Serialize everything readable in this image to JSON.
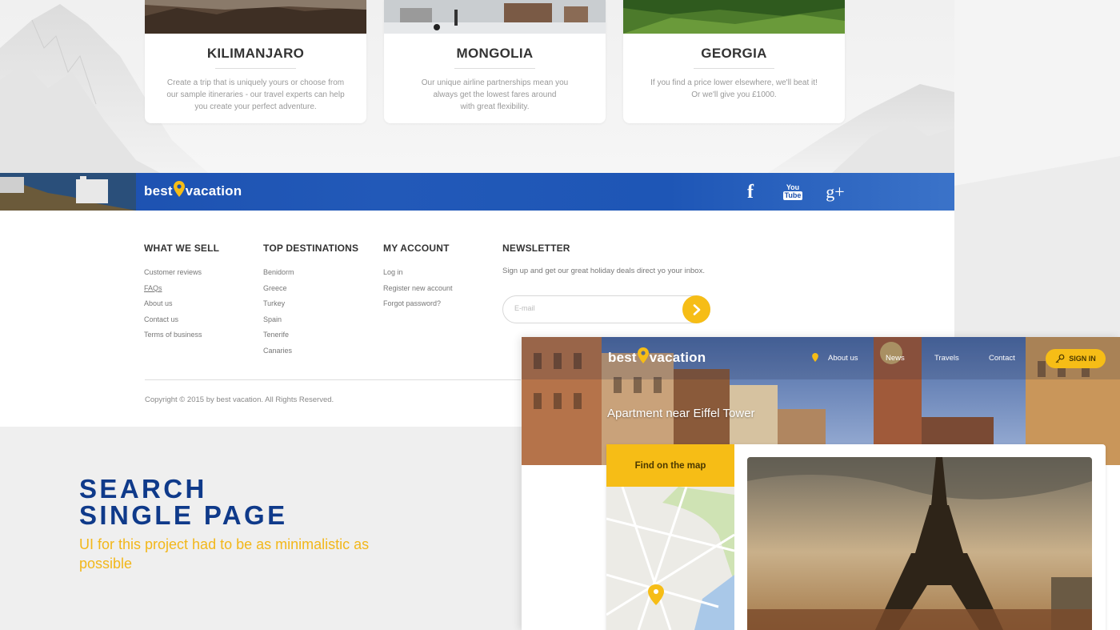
{
  "cards": [
    {
      "title": "KILIMANJARO",
      "lines": [
        "Create a trip that is uniquely yours or choose from",
        "our sample itineraries - our travel experts can help",
        "you create your perfect adventure."
      ]
    },
    {
      "title": "MONGOLIA",
      "lines": [
        "Our unique airline partnerships mean you",
        "always get the lowest fares around",
        "with great flexibility."
      ]
    },
    {
      "title": "GEORGIA",
      "lines": [
        "If you find a price lower elsewhere, we'll beat it!",
        "Or we'll give you £1000."
      ]
    }
  ],
  "brand": {
    "left": "best",
    "right": "vacation"
  },
  "social": {
    "facebook": "f",
    "youtube_top": "You",
    "youtube_bottom": "Tube",
    "google": "g+"
  },
  "footer": {
    "columns": [
      {
        "heading": "WHAT WE SELL",
        "items": [
          "Customer reviews",
          "FAQs",
          "About us",
          "Contact us",
          "Terms of business"
        ]
      },
      {
        "heading": "TOP DESTINATIONS",
        "items": [
          "Benidorm",
          "Greece",
          "Turkey",
          "Spain",
          "Tenerife",
          "Canaries"
        ]
      },
      {
        "heading": "MY ACCOUNT",
        "items": [
          "Log in",
          "Register new account",
          "Forgot password?"
        ]
      }
    ],
    "newsletter": {
      "heading": "NEWSLETTER",
      "text": "Sign up and get our great holiday deals direct yo your inbox.",
      "email_placeholder": "E-mail"
    },
    "copyright": "Copyright © 2015 by best vacation. All Rights Reserved."
  },
  "promo": {
    "title_line1": "SEARCH",
    "title_line2": "SINGLE PAGE",
    "subtitle": "UI for this project had to be as minimalistic as possible"
  },
  "detail_page": {
    "nav": [
      "About us",
      "News",
      "Travels",
      "Contact"
    ],
    "signin": "SIGN IN",
    "hero_title": "Apartment near Eiffel Tower",
    "map_tab": "Find on the map"
  },
  "colors": {
    "accent": "#f6bd16",
    "brand_blue": "#1b4fae",
    "promo_blue": "#0f3a8a"
  }
}
